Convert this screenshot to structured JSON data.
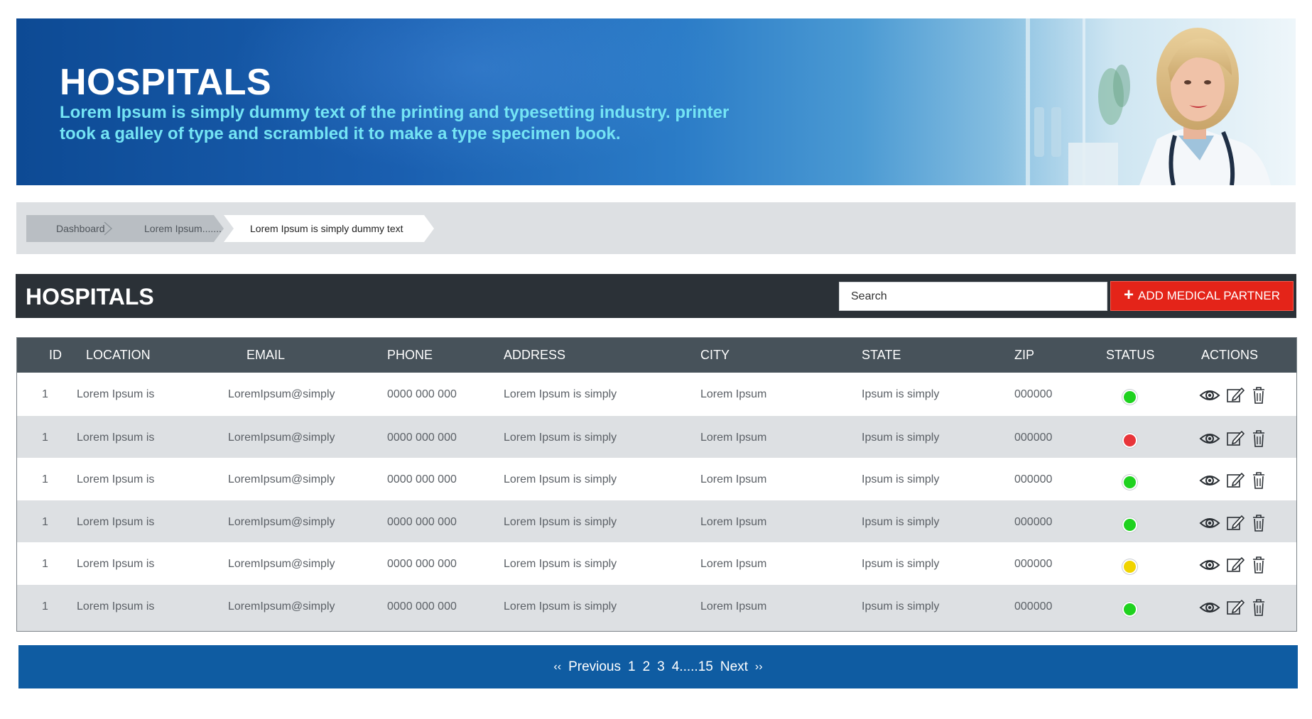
{
  "banner": {
    "title": "HOSPITALS",
    "subtitle": "Lorem Ipsum is simply dummy text of the printing and typesetting industry. printer took a galley of type and scrambled it to make a type specimen book."
  },
  "breadcrumb": [
    "Dashboard",
    "Lorem Ipsum.......",
    "Lorem Ipsum is simply dummy text"
  ],
  "section": {
    "title": "HOSPITALS",
    "search_placeholder": "Search",
    "add_label": "ADD MEDICAL PARTNER"
  },
  "table": {
    "headers": [
      "ID",
      "LOCATION",
      "EMAIL",
      "PHONE",
      "ADDRESS",
      "CITY",
      "STATE",
      "ZIP",
      "STATUS",
      "ACTIONS"
    ],
    "rows": [
      {
        "id": "1",
        "location": "Lorem Ipsum is",
        "email": "LoremIpsum@simply",
        "phone": "0000 000  000",
        "address": "Lorem Ipsum is simply",
        "city": "Lorem Ipsum",
        "state": "Ipsum is simply",
        "zip": "000000",
        "status": "green"
      },
      {
        "id": "1",
        "location": "Lorem Ipsum is",
        "email": "LoremIpsum@simply",
        "phone": "0000 000  000",
        "address": "Lorem Ipsum is simply",
        "city": "Lorem Ipsum",
        "state": "Ipsum is simply",
        "zip": "000000",
        "status": "red"
      },
      {
        "id": "1",
        "location": "Lorem Ipsum is",
        "email": "LoremIpsum@simply",
        "phone": "0000 000  000",
        "address": "Lorem Ipsum is simply",
        "city": "Lorem Ipsum",
        "state": "Ipsum is simply",
        "zip": "000000",
        "status": "green"
      },
      {
        "id": "1",
        "location": "Lorem Ipsum is",
        "email": "LoremIpsum@simply",
        "phone": "0000 000  000",
        "address": "Lorem Ipsum is simply",
        "city": "Lorem Ipsum",
        "state": "Ipsum is simply",
        "zip": "000000",
        "status": "green"
      },
      {
        "id": "1",
        "location": "Lorem Ipsum is",
        "email": "LoremIpsum@simply",
        "phone": "0000 000  000",
        "address": "Lorem Ipsum is simply",
        "city": "Lorem Ipsum",
        "state": "Ipsum is simply",
        "zip": "000000",
        "status": "yellow"
      },
      {
        "id": "1",
        "location": "Lorem Ipsum is",
        "email": "LoremIpsum@simply",
        "phone": "0000 000  000",
        "address": "Lorem Ipsum is simply",
        "city": "Lorem Ipsum",
        "state": "Ipsum is simply",
        "zip": "000000",
        "status": "green"
      }
    ],
    "action_icons": [
      "eye-icon",
      "edit-icon",
      "trash-icon"
    ]
  },
  "status_colors": {
    "green": "#1fd21f",
    "red": "#e8353a",
    "yellow": "#f0d400"
  },
  "pagination": {
    "prev_arrow": "‹‹",
    "prev_label": "Previous",
    "pages": [
      "1",
      "2",
      "3",
      "4.....15"
    ],
    "next_label": "Next",
    "next_arrow": "››"
  },
  "colors": {
    "header_dark": "#2b3137",
    "table_header": "#47525a",
    "accent_red": "#e42419",
    "pager_blue": "#0f5ca2"
  }
}
